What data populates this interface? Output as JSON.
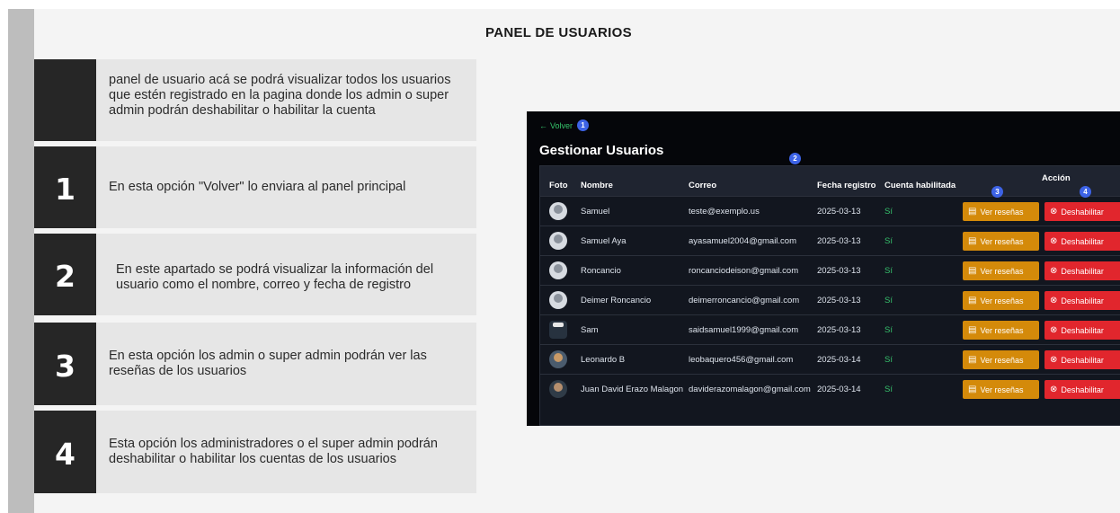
{
  "page_title": "PANEL DE USUARIOS",
  "steps": [
    {
      "number": "",
      "text": "panel de usuario acá se podrá visualizar todos los usuarios que estén registrado en la pagina donde los admin o super admin podrán deshabilitar o habilitar la cuenta"
    },
    {
      "number": "1",
      "text": "En esta opción \"Volver\" lo enviara al panel principal"
    },
    {
      "number": "2",
      "text": "En este apartado se podrá visualizar la información del usuario como el nombre, correo y fecha de registro"
    },
    {
      "number": "3",
      "text": "En esta opción los admin o super admin podrán ver las reseñas de los usuarios"
    },
    {
      "number": "4",
      "text": "Esta opción los administradores o el super admin podrán deshabilitar o habilitar los cuentas de los usuarios"
    }
  ],
  "screenshot": {
    "back_label": "Volver",
    "title": "Gestionar Usuarios",
    "markers": [
      "1",
      "2",
      "3",
      "4"
    ],
    "columns": {
      "foto": "Foto",
      "nombre": "Nombre",
      "correo": "Correo",
      "fecha": "Fecha registro",
      "habilitada": "Cuenta habilitada",
      "accion": "Acción"
    },
    "buttons": {
      "resenas": "Ver reseñas",
      "deshabilitar": "Deshabilitar"
    },
    "users": [
      {
        "nombre": "Samuel",
        "correo": "teste@exemplo.us",
        "fecha": "2025-03-13",
        "habilitada": "Sí"
      },
      {
        "nombre": "Samuel Aya",
        "correo": "ayasamuel2004@gmail.com",
        "fecha": "2025-03-13",
        "habilitada": "Sí"
      },
      {
        "nombre": "Roncancio",
        "correo": "roncanciodeison@gmail.com",
        "fecha": "2025-03-13",
        "habilitada": "Sí"
      },
      {
        "nombre": "Deimer Roncancio",
        "correo": "deimerroncancio@gmail.com",
        "fecha": "2025-03-13",
        "habilitada": "Sí"
      },
      {
        "nombre": "Sam",
        "correo": "saidsamuel1999@gmail.com",
        "fecha": "2025-03-13",
        "habilitada": "Sí"
      },
      {
        "nombre": "Leonardo B",
        "correo": "leobaquero456@gmail.com",
        "fecha": "2025-03-14",
        "habilitada": "Sí"
      },
      {
        "nombre": "Juan David Erazo Malagon",
        "correo": "daviderazomalagon@gmail.com",
        "fecha": "2025-03-14",
        "habilitada": "Sí"
      }
    ]
  }
}
